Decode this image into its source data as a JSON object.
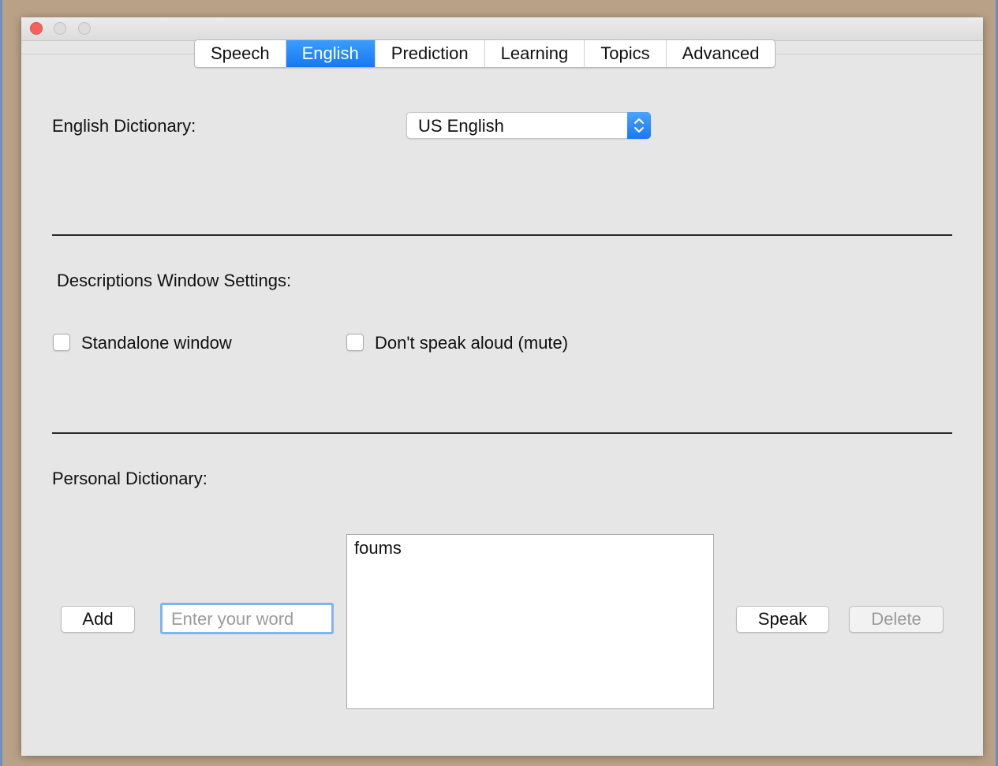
{
  "tabs": [
    {
      "label": "Speech",
      "active": false
    },
    {
      "label": "English",
      "active": true
    },
    {
      "label": "Prediction",
      "active": false
    },
    {
      "label": "Learning",
      "active": false
    },
    {
      "label": "Topics",
      "active": false
    },
    {
      "label": "Advanced",
      "active": false
    }
  ],
  "english_dictionary": {
    "label": "English Dictionary:",
    "selected": "US English"
  },
  "descriptions": {
    "heading": "Descriptions Window Settings:",
    "standalone_label": "Standalone window",
    "standalone_checked": false,
    "mute_label": "Don't speak aloud (mute)",
    "mute_checked": false
  },
  "personal_dictionary": {
    "heading": "Personal Dictionary:",
    "add_label": "Add",
    "input_placeholder": "Enter your word",
    "words": [
      "foums"
    ],
    "speak_label": "Speak",
    "delete_label": "Delete"
  },
  "colors": {
    "accent": "#1a78f0",
    "close_light": "#fc605c"
  }
}
